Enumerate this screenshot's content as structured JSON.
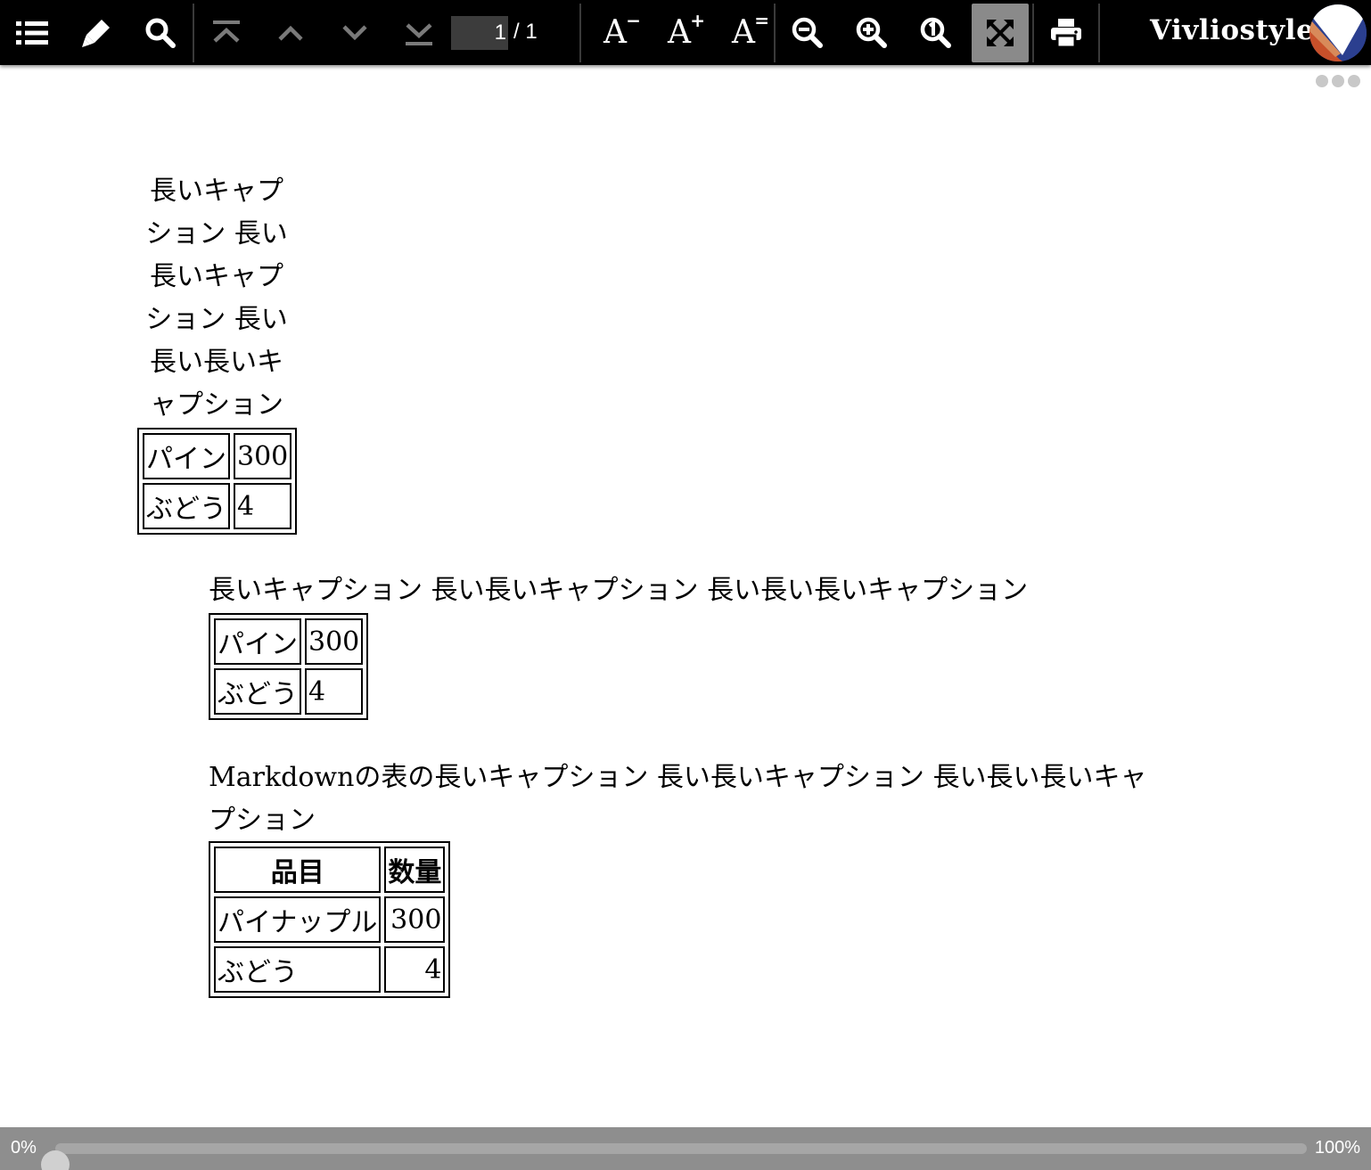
{
  "toolbar": {
    "buttons": {
      "toc": "table-of-contents",
      "marker": "marker-pen",
      "search": "search",
      "first_page": "first-page",
      "prev_page": "previous-page",
      "next_page": "next-page",
      "last_page": "last-page",
      "font_smaller": "font-size-decrease",
      "font_larger": "font-size-increase",
      "font_default": "font-size-reset",
      "zoom_out": "zoom-out",
      "zoom_in": "zoom-in",
      "zoom_actual": "zoom-actual-size",
      "fit_page": "fit-to-page",
      "print": "print"
    },
    "font_buttons": {
      "decrease": {
        "glyph": "A",
        "mark": "−"
      },
      "increase": {
        "glyph": "A",
        "mark": "+"
      },
      "reset": {
        "glyph": "A",
        "mark": "="
      }
    },
    "page_input_value": "1",
    "page_total": "/ 1",
    "brand": "Vivliostyle",
    "colors": {
      "bar": "#000000",
      "active": "#8a8a8a",
      "disabled": "#7a7a7a"
    }
  },
  "document": {
    "caption1_lines": [
      "長いキャプ",
      "ション 長い",
      "長いキャプ",
      "ション 長い",
      "長い長いキ",
      "ャプション"
    ],
    "table1": [
      [
        "パイン",
        "300"
      ],
      [
        "ぶどう",
        "4"
      ]
    ],
    "caption2": "長いキャプション 長い長いキャプション 長い長い長いキャプション",
    "table2": [
      [
        "パイン",
        "300"
      ],
      [
        "ぶどう",
        "4"
      ]
    ],
    "caption3": "Markdownの表の長いキャプション 長い長いキャプション 長い長い長いキャプション",
    "table3": {
      "headers": [
        "品目",
        "数量"
      ],
      "rows": [
        [
          "パイナップル",
          "300"
        ],
        [
          "ぶどう",
          "4"
        ]
      ]
    }
  },
  "progress": {
    "left_label": "0%",
    "right_label": "100%",
    "value": 0
  }
}
